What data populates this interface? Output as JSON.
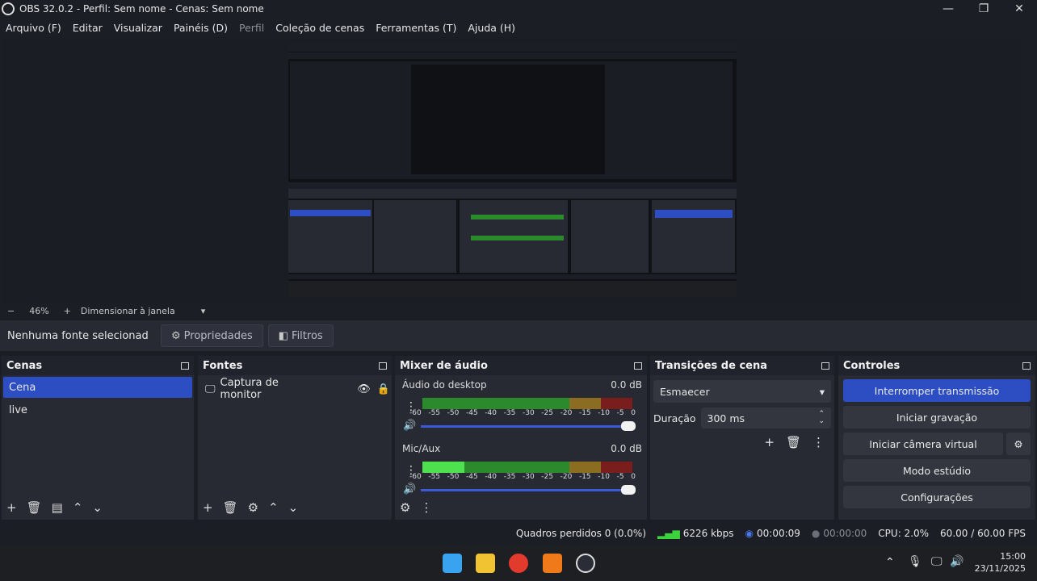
{
  "window": {
    "title": "OBS 32.0.2 - Perfil: Sem nome - Cenas: Sem nome"
  },
  "menu": [
    "Arquivo (F)",
    "Editar",
    "Visualizar",
    "Painéis (D)",
    "Perfil",
    "Coleção de cenas",
    "Ferramentas (T)",
    "Ajuda (H)"
  ],
  "zoom": {
    "value": "46%",
    "mode": "Dimensionar à janela"
  },
  "source_bar": {
    "label": "Nenhuma fonte selecionad",
    "properties": "Propriedades",
    "filters": "Filtros"
  },
  "scenes": {
    "title": "Cenas",
    "items": [
      "Cena",
      "live"
    ]
  },
  "sources": {
    "title": "Fontes",
    "items": [
      "Captura de monitor"
    ]
  },
  "mixer": {
    "title": "Mixer de áudio",
    "channels": [
      {
        "name": "Áudio do desktop",
        "db": "0.0 dB",
        "level": 0
      },
      {
        "name": "Mic/Aux",
        "db": "0.0 dB",
        "level": 0.2
      }
    ],
    "ticks": [
      "-60",
      "-55",
      "-50",
      "-45",
      "-40",
      "-35",
      "-30",
      "-25",
      "-20",
      "-15",
      "-10",
      "-5",
      "0"
    ]
  },
  "transitions": {
    "title": "Transições de cena",
    "type": "Esmaecer",
    "duration_label": "Duração",
    "duration": "300 ms"
  },
  "controls": {
    "title": "Controles",
    "stop_stream": "Interromper transmissão",
    "start_recording": "Iniciar gravação",
    "start_virtual_cam": "Iniciar câmera virtual",
    "studio_mode": "Modo estúdio",
    "settings": "Configurações"
  },
  "status": {
    "dropped": "Quadros perdidos 0 (0.0%)",
    "bitrate": "6226 kbps",
    "stream_time": "00:00:09",
    "rec_time": "00:00:00",
    "cpu": "CPU: 2.0%",
    "fps": "60.00 / 60.00 FPS"
  },
  "taskbar": {
    "time": "15:00",
    "date": "23/11/2025"
  }
}
